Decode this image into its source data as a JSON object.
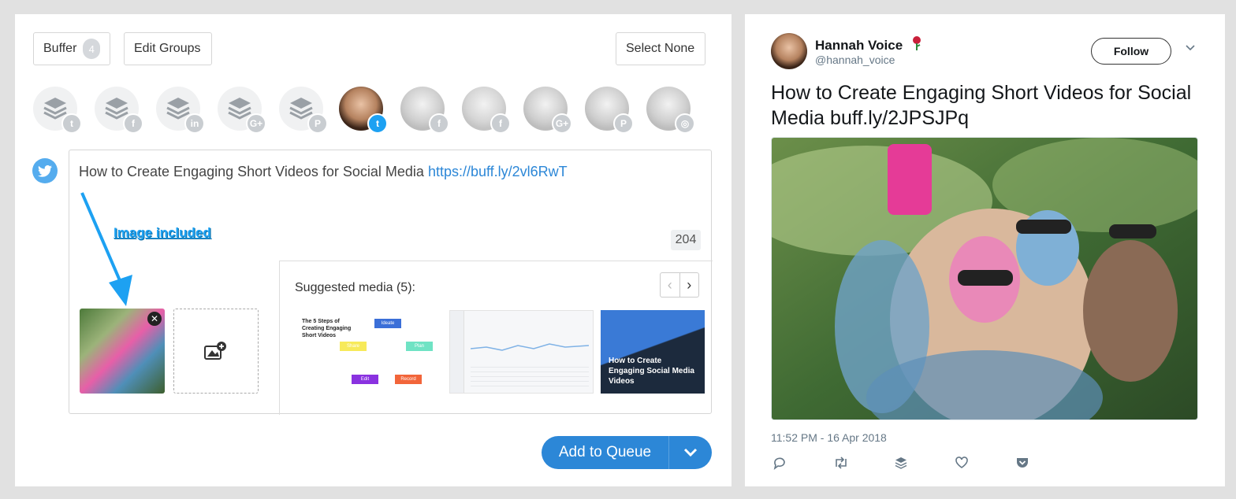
{
  "composer_panel": {
    "buffer_button": {
      "label": "Buffer",
      "count": "4"
    },
    "edit_groups_label": "Edit Groups",
    "select_none_label": "Select None",
    "profiles": [
      {
        "type": "group",
        "network": "twitter"
      },
      {
        "type": "group",
        "network": "facebook"
      },
      {
        "type": "group",
        "network": "linkedin"
      },
      {
        "type": "group",
        "network": "google-plus"
      },
      {
        "type": "group",
        "network": "pinterest"
      },
      {
        "type": "person",
        "network": "twitter",
        "selected": true
      },
      {
        "type": "person",
        "network": "facebook"
      },
      {
        "type": "person",
        "network": "facebook"
      },
      {
        "type": "person",
        "network": "google-plus"
      },
      {
        "type": "person",
        "network": "pinterest"
      },
      {
        "type": "person",
        "network": "instagram"
      }
    ],
    "post_text": "How to Create Engaging Short Videos for Social Media",
    "post_link": "https://buff.ly/2vl6RwT",
    "char_count": "204",
    "annotation": "Image included",
    "suggested_title": "Suggested media (5):",
    "suggested_items": [
      {
        "title": "The 5 Steps of Creating Engaging Short Videos",
        "steps": [
          "Ideate",
          "Plan",
          "Record",
          "Edit",
          "Share"
        ]
      },
      {
        "title": ""
      },
      {
        "title": "How to Create Engaging Social Media Videos"
      }
    ],
    "add_to_queue_label": "Add to Queue"
  },
  "tweet_panel": {
    "name": "Hannah Voice",
    "handle": "@hannah_voice",
    "follow_label": "Follow",
    "text": "How to Create Engaging Short Videos for Social Media",
    "link": "buff.ly/2JPSJPq",
    "timestamp": "11:52 PM - 16 Apr 2018"
  },
  "colors": {
    "accent": "#2c87d7",
    "twitter": "#1da1f2"
  }
}
